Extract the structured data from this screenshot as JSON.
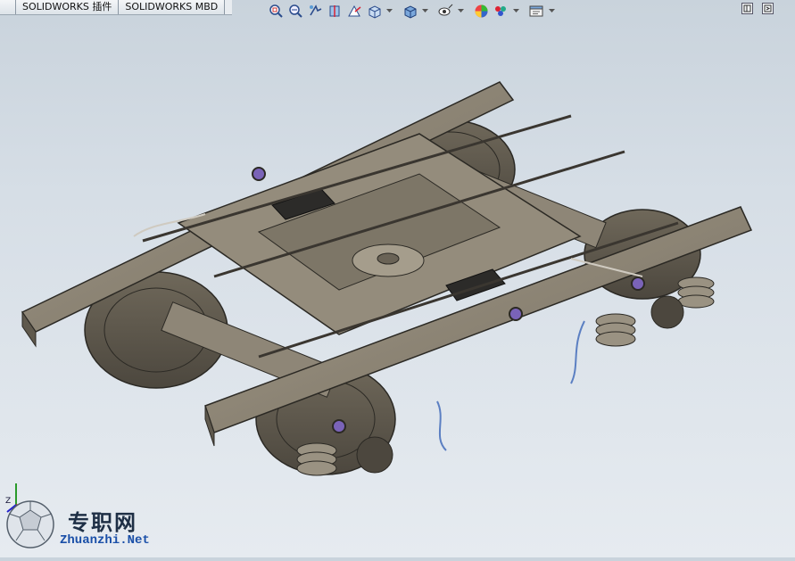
{
  "tabs": [
    "",
    "SOLIDWORKS 插件",
    "SOLIDWORKS MBD"
  ],
  "heads_up_toolbar": [
    {
      "name": "zoom-to-fit-icon"
    },
    {
      "name": "zoom-to-area-icon"
    },
    {
      "name": "previous-view-icon"
    },
    {
      "name": "section-view-icon"
    },
    {
      "name": "dynamic-annotation-icon"
    },
    {
      "name": "view-orientation-icon"
    },
    {
      "name": "display-style-icon"
    },
    {
      "name": "hide-show-items-icon"
    },
    {
      "name": "edit-appearance-icon"
    },
    {
      "name": "apply-scene-icon"
    },
    {
      "name": "view-settings-icon"
    }
  ],
  "triad_label": "Z",
  "watermark": {
    "cn": "专职网",
    "en": "Zhuanzhi.Net"
  },
  "colors": {
    "metal": "#8a8272",
    "metal_dark": "#5f594d",
    "edge": "#2b2924",
    "accent_blue": "#5b7fc2",
    "accent_purple": "#7a63b8"
  }
}
